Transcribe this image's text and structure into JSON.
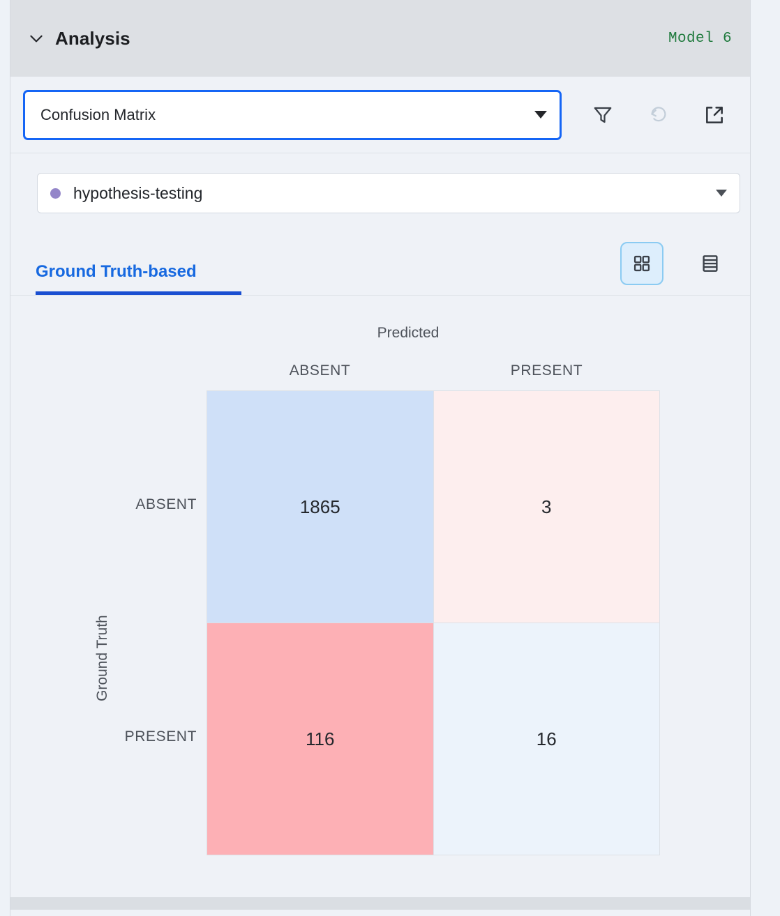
{
  "header": {
    "title": "Analysis",
    "model_tag": "Model 6",
    "collapse_icon": "chevron-down-icon"
  },
  "toolbar": {
    "chart_select_value": "Confusion Matrix",
    "filter_icon": "filter-funnel-icon",
    "reset_icon": "reset-refresh-icon",
    "expand_icon": "open-external-icon"
  },
  "dataset": {
    "value": "hypothesis-testing",
    "dot_color": "#9486c9"
  },
  "tabs": {
    "active": "Ground Truth-based",
    "grid_view_icon": "grid-view-icon",
    "table_view_icon": "table-view-icon"
  },
  "chart_data": {
    "type": "heatmap",
    "title": "Confusion Matrix",
    "xlabel": "Predicted",
    "ylabel": "Ground Truth",
    "categories": [
      "ABSENT",
      "PRESENT"
    ],
    "row_labels": [
      "ABSENT",
      "PRESENT"
    ],
    "col_labels": [
      "ABSENT",
      "PRESENT"
    ],
    "cells": [
      {
        "row": "ABSENT",
        "col": "ABSENT",
        "value": "1865",
        "color": "#cfe0f8"
      },
      {
        "row": "ABSENT",
        "col": "PRESENT",
        "value": "3",
        "color": "#fdeeee"
      },
      {
        "row": "PRESENT",
        "col": "ABSENT",
        "value": "116",
        "color": "#fdb0b5"
      },
      {
        "row": "PRESENT",
        "col": "PRESENT",
        "value": "16",
        "color": "#ecf3fb"
      }
    ],
    "values": [
      [
        1865,
        3
      ],
      [
        116,
        16
      ]
    ],
    "grid": true,
    "legend": "none"
  },
  "colors": {
    "accent_blue": "#1565f5",
    "tab_blue": "#1769e0",
    "model_green": "#1f7a3d",
    "header_bg": "#dde0e4",
    "body_bg": "#eff2f7"
  }
}
